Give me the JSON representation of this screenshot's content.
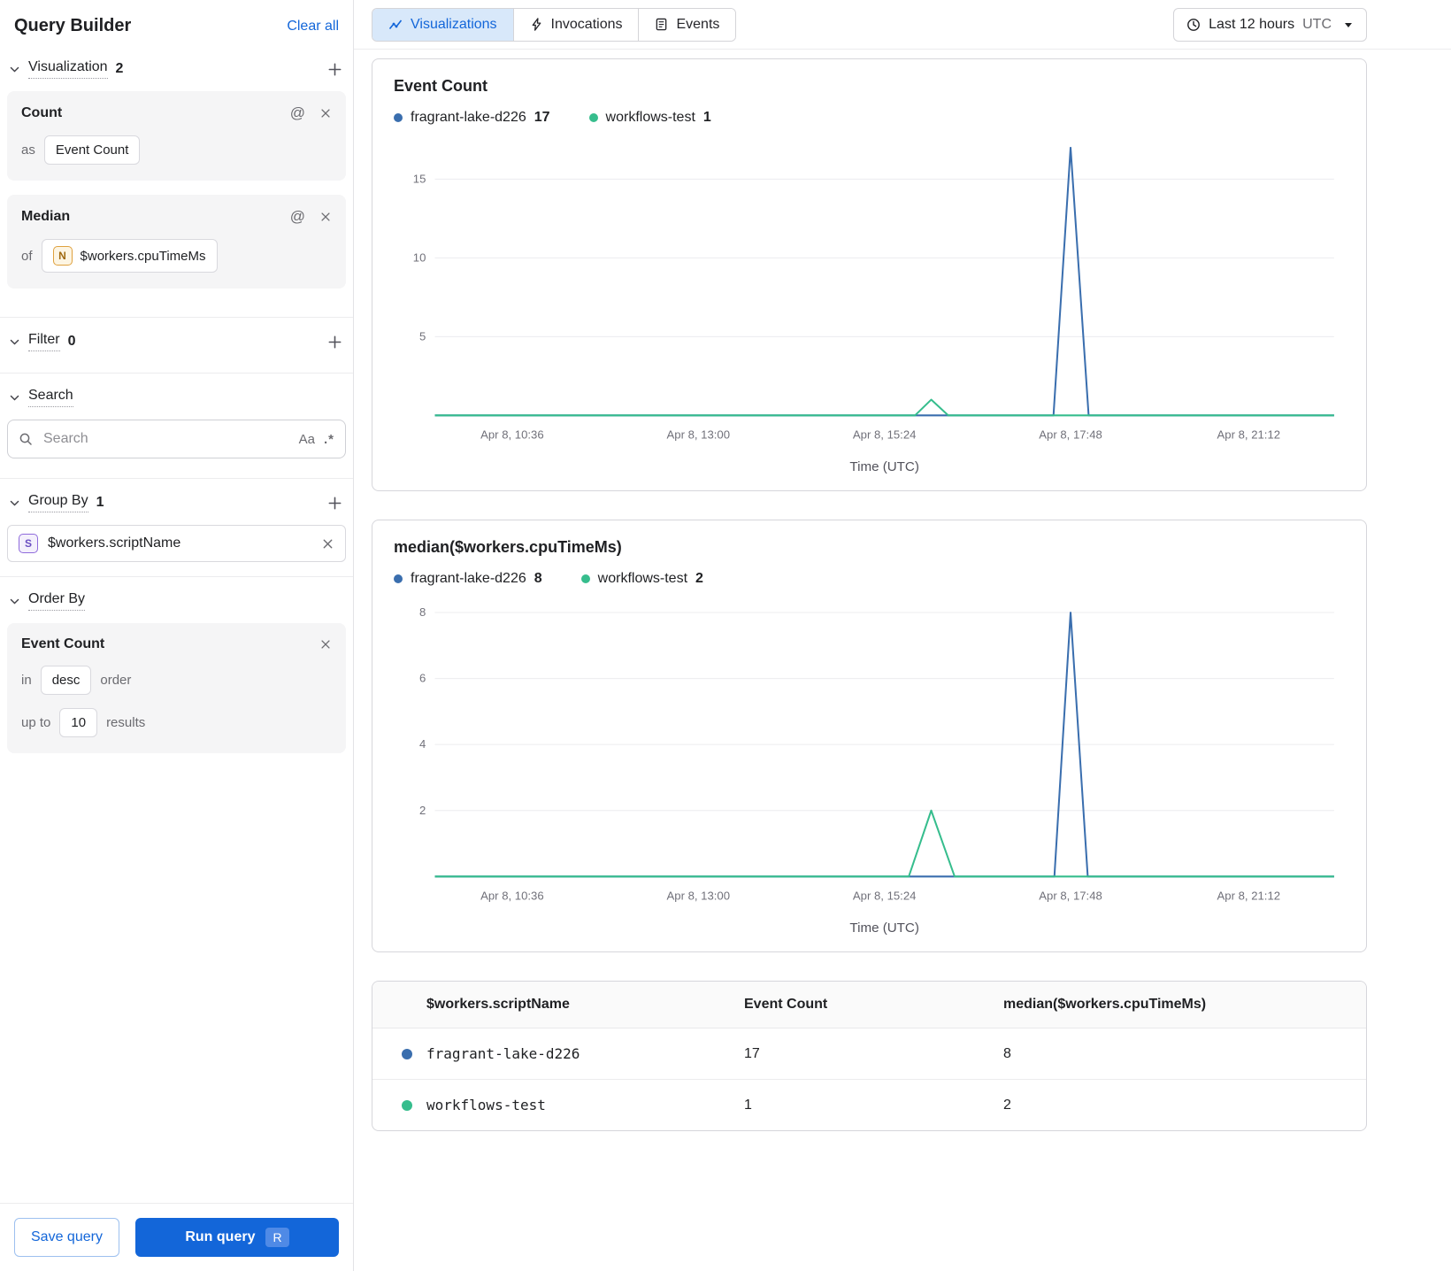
{
  "colors": {
    "accent_blue": "#1366d9",
    "tab_active_bg": "#d8e8fa",
    "series_blue": "#3a6eae",
    "series_green": "#36bd8d"
  },
  "icons": {
    "at": "@",
    "case": "Aa",
    "regex": ".*"
  },
  "sidebar": {
    "title": "Query Builder",
    "clear_all": "Clear all",
    "visualization": {
      "label": "Visualization",
      "count": "2",
      "cards": [
        {
          "title": "Count",
          "prefix": "as",
          "value": "Event Count"
        },
        {
          "title": "Median",
          "prefix": "of",
          "chip_letter": "N",
          "value": "$workers.cpuTimeMs"
        }
      ]
    },
    "filter": {
      "label": "Filter",
      "count": "0"
    },
    "search": {
      "label": "Search",
      "placeholder": "Search"
    },
    "group_by": {
      "label": "Group By",
      "count": "1",
      "item": {
        "chip_letter": "S",
        "value": "$workers.scriptName"
      }
    },
    "order_by": {
      "label": "Order By",
      "field": "Event Count",
      "in_label": "in",
      "direction": "desc",
      "order_label": "order",
      "upto_label": "up to",
      "limit": "10",
      "results_label": "results"
    },
    "save_button": "Save query",
    "run_button": "Run query",
    "run_shortcut": "R"
  },
  "header": {
    "tabs": [
      {
        "label": "Visualizations"
      },
      {
        "label": "Invocations"
      },
      {
        "label": "Events"
      }
    ],
    "time_range": {
      "label": "Last 12 hours",
      "zone": "UTC"
    }
  },
  "chart_data": [
    {
      "type": "line",
      "title": "Event Count",
      "legend": [
        {
          "name": "fragrant-lake-d226",
          "value": "17",
          "color": "#3a6eae"
        },
        {
          "name": "workflows-test",
          "value": "1",
          "color": "#36bd8d"
        }
      ],
      "xlabel": "Time (UTC)",
      "x_ticks": [
        {
          "label": "Apr 8, 10:36",
          "pos": 0.086
        },
        {
          "label": "Apr 8, 13:00",
          "pos": 0.293
        },
        {
          "label": "Apr 8, 15:24",
          "pos": 0.5
        },
        {
          "label": "Apr 8, 17:48",
          "pos": 0.707
        },
        {
          "label": "Apr 8, 21:12",
          "pos": 0.905
        }
      ],
      "y_ticks": [
        5,
        10,
        15
      ],
      "ylim": [
        0,
        17.6
      ],
      "series": [
        {
          "name": "fragrant-lake-d226",
          "color": "#3a6eae",
          "points": [
            [
              0,
              0
            ],
            [
              0.688,
              0
            ],
            [
              0.707,
              17
            ],
            [
              0.727,
              0
            ],
            [
              1,
              0
            ]
          ]
        },
        {
          "name": "workflows-test",
          "color": "#36bd8d",
          "points": [
            [
              0,
              0
            ],
            [
              0.534,
              0
            ],
            [
              0.552,
              1
            ],
            [
              0.571,
              0
            ],
            [
              1,
              0
            ]
          ]
        }
      ]
    },
    {
      "type": "line",
      "title": "median($workers.cpuTimeMs)",
      "legend": [
        {
          "name": "fragrant-lake-d226",
          "value": "8",
          "color": "#3a6eae"
        },
        {
          "name": "workflows-test",
          "value": "2",
          "color": "#36bd8d"
        }
      ],
      "xlabel": "Time (UTC)",
      "x_ticks": [
        {
          "label": "Apr 8, 10:36",
          "pos": 0.086
        },
        {
          "label": "Apr 8, 13:00",
          "pos": 0.293
        },
        {
          "label": "Apr 8, 15:24",
          "pos": 0.5
        },
        {
          "label": "Apr 8, 17:48",
          "pos": 0.707
        },
        {
          "label": "Apr 8, 21:12",
          "pos": 0.905
        }
      ],
      "y_ticks": [
        2,
        4,
        6,
        8
      ],
      "ylim": [
        0,
        8.4
      ],
      "series": [
        {
          "name": "fragrant-lake-d226",
          "color": "#3a6eae",
          "points": [
            [
              0,
              0
            ],
            [
              0.689,
              0
            ],
            [
              0.707,
              8
            ],
            [
              0.726,
              0
            ],
            [
              1,
              0
            ]
          ]
        },
        {
          "name": "workflows-test",
          "color": "#36bd8d",
          "points": [
            [
              0,
              0
            ],
            [
              0.527,
              0
            ],
            [
              0.552,
              2
            ],
            [
              0.578,
              0
            ],
            [
              1,
              0
            ]
          ]
        }
      ]
    }
  ],
  "table": {
    "columns": [
      "$workers.scriptName",
      "Event Count",
      "median($workers.cpuTimeMs)"
    ],
    "rows": [
      {
        "color": "#3a6eae",
        "name": "fragrant-lake-d226",
        "event_count": "17",
        "median": "8"
      },
      {
        "color": "#36bd8d",
        "name": "workflows-test",
        "event_count": "1",
        "median": "2"
      }
    ]
  }
}
